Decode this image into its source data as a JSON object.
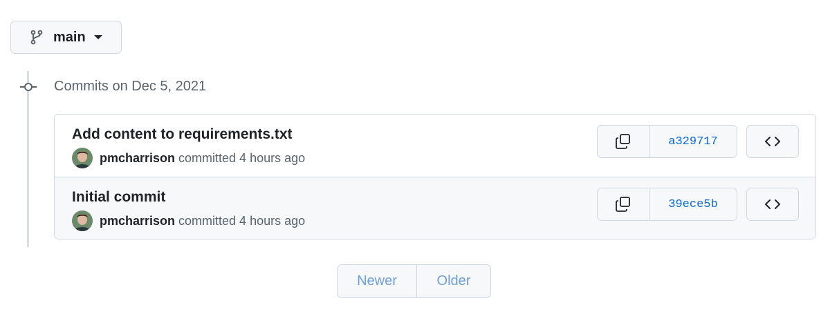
{
  "branch": {
    "name": "main",
    "icon": "git-branch-icon"
  },
  "group": {
    "title": "Commits on Dec 5, 2021"
  },
  "commits": [
    {
      "title": "Add content to requirements.txt",
      "author": "pmcharrison",
      "action": "committed 4 hours ago",
      "sha": "a329717"
    },
    {
      "title": "Initial commit",
      "author": "pmcharrison",
      "action": "committed 4 hours ago",
      "sha": "39ece5b"
    }
  ],
  "pagination": {
    "newer_label": "Newer",
    "older_label": "Older"
  },
  "colors": {
    "link": "#0969da",
    "border": "#d0d7de",
    "muted": "#59636e",
    "disabled_link": "#6e9fd8"
  }
}
